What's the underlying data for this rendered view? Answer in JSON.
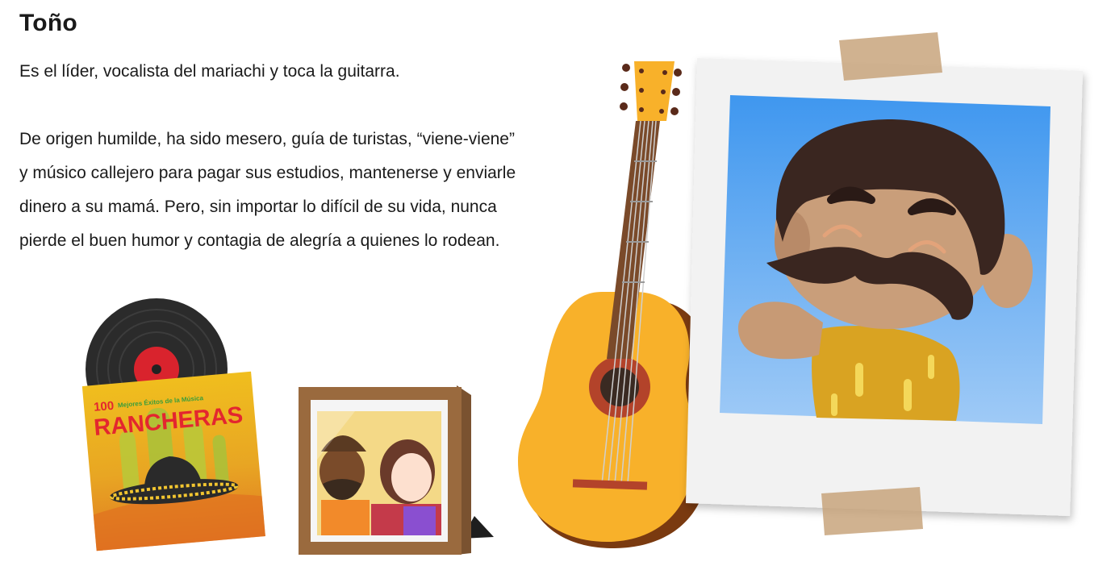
{
  "character": {
    "name": "Toño",
    "intro": "Es el líder, vocalista del mariachi y toca la guitarra.",
    "bio_lines": [
      "De origen humilde, ha sido mesero, guía de turistas, “viene-viene”",
      "y músico callejero para pagar sus estudios, mantenerse y enviarle",
      "dinero a su mamá. Pero, sin importar lo difícil de su vida, nunca",
      "pierde el buen humor y contagia de alegría a quienes lo rodean."
    ]
  },
  "album": {
    "number": "100",
    "subtitle": "Mejores Éxitos de la Música",
    "title": "RANCHERAS"
  },
  "icons": {
    "record": "vinyl-record-icon",
    "album": "album-cover-icon",
    "frame": "photo-frame-icon",
    "guitar": "guitar-icon",
    "polaroid": "polaroid-photo-icon"
  },
  "colors": {
    "album_red": "#e3262f",
    "guitar_yellow": "#f8b12a",
    "frame_brown": "#9a6a3e",
    "sky_blue": "#5aa6ef"
  }
}
